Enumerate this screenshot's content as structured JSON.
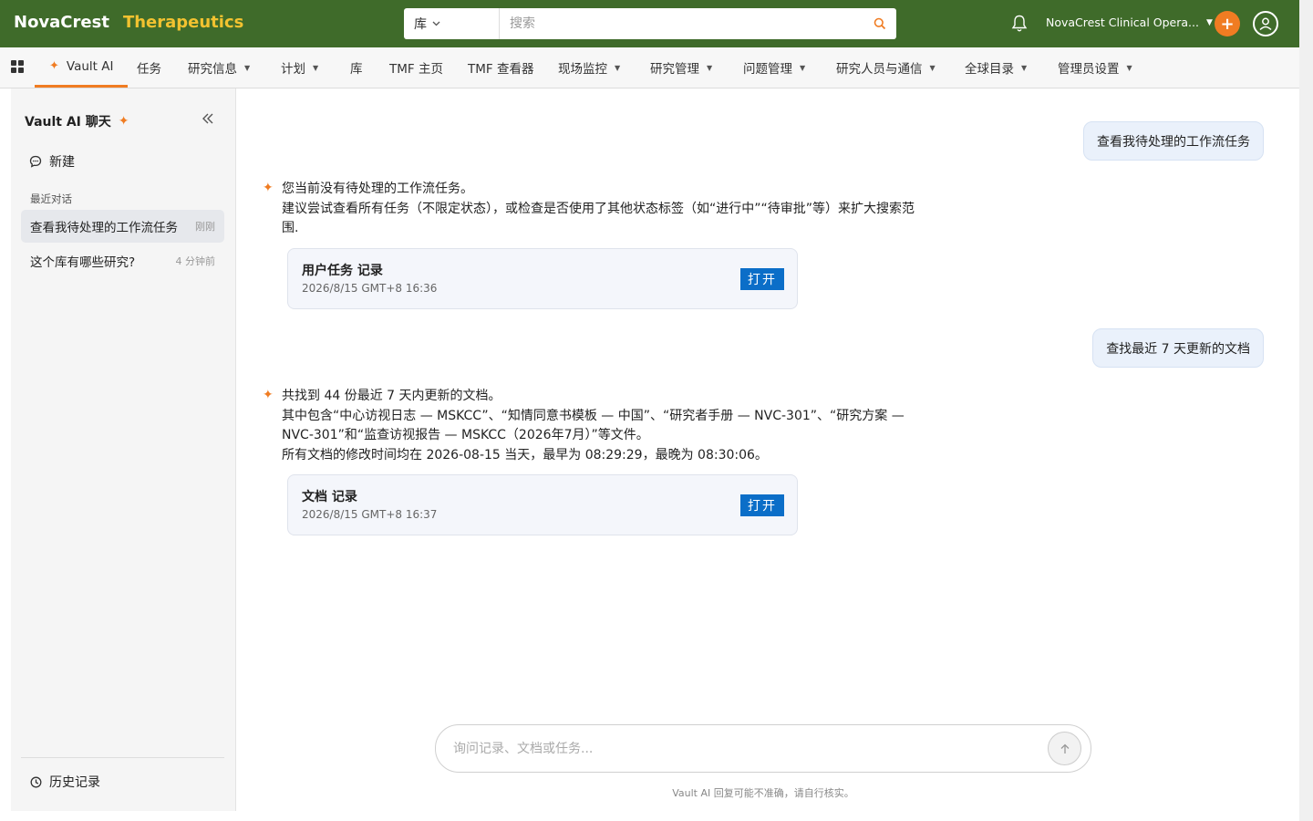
{
  "header": {
    "brand_name": "NovaCrest",
    "brand_suffix": "Therapeutics",
    "search_scope": "库",
    "search_placeholder": "搜索",
    "org_name": "NovaCrest Clinical Opera...",
    "colors": {
      "header_bg": "#3f6b2a",
      "brand_accent": "#f2c230",
      "accent": "#f07c22",
      "button_blue": "#0b6ec8"
    }
  },
  "nav": {
    "items": [
      {
        "label": "Vault AI",
        "active": true
      },
      {
        "label": "任务"
      },
      {
        "label": "研究信息",
        "dropdown": true
      },
      {
        "label": "计划",
        "dropdown": true
      },
      {
        "label": "库"
      },
      {
        "label": "TMF 主页"
      },
      {
        "label": "TMF 查看器"
      },
      {
        "label": "现场监控",
        "dropdown": true
      },
      {
        "label": "研究管理",
        "dropdown": true
      },
      {
        "label": "问题管理",
        "dropdown": true
      },
      {
        "label": "研究人员与通信",
        "dropdown": true
      },
      {
        "label": "全球目录",
        "dropdown": true
      },
      {
        "label": "管理员设置",
        "dropdown": true
      }
    ]
  },
  "sidebar": {
    "title": "Vault AI 聊天",
    "new_label": "新建",
    "recent_label": "最近对话",
    "conversations": [
      {
        "title": "查看我待处理的工作流任务",
        "time": "刚刚",
        "active": true
      },
      {
        "title": "这个库有哪些研究?",
        "time": "4 分钟前",
        "active": false
      }
    ],
    "history_label": "历史记录"
  },
  "chat": {
    "messages": [
      {
        "role": "user",
        "text": "查看我待处理的工作流任务"
      },
      {
        "role": "ai",
        "lines": [
          "您当前没有待处理的工作流任务。",
          "建议尝试查看所有任务（不限定状态），或检查是否使用了其他状态标签（如“进行中”“待审批”等）来扩大搜索范围."
        ],
        "record": {
          "title": "用户任务 记录",
          "date": "2026/8/15 GMT+8 16:36",
          "open_label": "打开"
        }
      },
      {
        "role": "user",
        "text": "查找最近 7 天更新的文档"
      },
      {
        "role": "ai",
        "lines": [
          "共找到 44 份最近 7 天内更新的文档。",
          "其中包含“中心访视日志 — MSKCC”、“知情同意书模板 — 中国”、“研究者手册 — NVC-301”、“研究方案 — NVC-301”和“监查访视报告 — MSKCC（2026年7月）”等文件。",
          "所有文档的修改时间均在 2026-08-15 当天，最早为 08:29:29，最晚为 08:30:06。"
        ],
        "record": {
          "title": "文档 记录",
          "date": "2026/8/15 GMT+8 16:37",
          "open_label": "打开"
        }
      }
    ],
    "composer_placeholder": "询问记录、文档或任务...",
    "disclaimer": "Vault AI 回复可能不准确，请自行核实。"
  }
}
